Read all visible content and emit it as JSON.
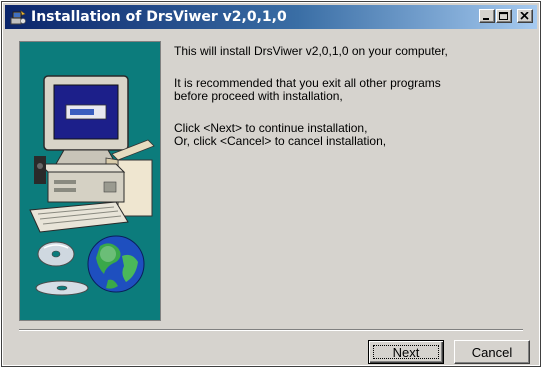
{
  "window": {
    "title": "Installation of DrsViwer v2,0,1,0",
    "title_icon": "installer-icon",
    "controls": [
      "minimize-icon",
      "maximize-icon",
      "close-icon"
    ]
  },
  "message": {
    "line1": "This will install DrsViwer v2,0,1,0 on your computer,",
    "line2a": "It is recommended that you exit all other programs",
    "line2b": "before proceed with installation,",
    "line3a": "Click <Next> to continue installation,",
    "line3b": "Or, click <Cancel> to cancel installation,"
  },
  "buttons": {
    "next_label": "Next",
    "cancel_label": "Cancel"
  },
  "colors": {
    "title_start": "#0a246a",
    "title_end": "#a6caf0",
    "panel_bg": "#0c7c7c",
    "dialog_bg": "#d6d3ce"
  },
  "panel": {
    "illustration": "computer-with-cd-and-globe"
  }
}
